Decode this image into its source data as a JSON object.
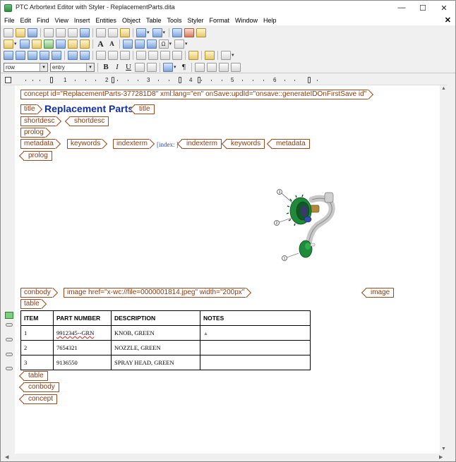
{
  "window": {
    "title": "PTC Arbortext Editor with Styler - ReplacementParts.dita",
    "controls": {
      "minimize": "—",
      "maximize": "☐",
      "close": "✕"
    }
  },
  "menu": {
    "items": [
      "File",
      "Edit",
      "Find",
      "View",
      "Insert",
      "Entities",
      "Object",
      "Table",
      "Tools",
      "Styler",
      "Format",
      "Window",
      "Help"
    ],
    "doc_close": "✕"
  },
  "toolbar": {
    "element_combo": "row",
    "style_combo": "entry",
    "format_buttons": {
      "bold": "B",
      "italic": "I",
      "underline": "U"
    },
    "pilcrow": "¶",
    "font_grow": "A",
    "font_shrink": "A"
  },
  "ruler": {
    "numbers": [
      "1",
      "2",
      "3",
      "4",
      "5",
      "6"
    ]
  },
  "document": {
    "concept_start": "concept id=\"ReplacementParts-377281D8\" xml:lang=\"en\" onSave:updId=\"onsave::generateIDOnFirstSave id\"",
    "title_tag": "title",
    "title_text": "Replacement Parts",
    "shortdesc_tag": "shortdesc",
    "prolog_tag": "prolog",
    "metadata_tag": "metadata",
    "keywords_tag": "keywords",
    "indexterm_tag": "indexterm",
    "index_text": "[index: ]",
    "conbody_tag": "conbody",
    "image_start": "image href=\"x-wc://file=0000001814.jpeg\" width=\"200px\"",
    "image_tag": "image",
    "table_tag": "table",
    "concept_tag": "concept"
  },
  "figure": {
    "callouts": [
      "3",
      "2",
      "1"
    ],
    "colors": {
      "green": "#1f8a3a",
      "brass": "#b08a3a",
      "silver": "#b8b8b8"
    }
  },
  "table": {
    "headers": [
      "ITEM",
      "PART NUMBER",
      "DESCRIPTION",
      "NOTES"
    ],
    "rows": [
      {
        "item": "1",
        "part": "9912345--GRN",
        "desc": "KNOB, GREEN",
        "notes": ""
      },
      {
        "item": "2",
        "part": "7654321",
        "desc": "NOZZLE, GREEN",
        "notes": ""
      },
      {
        "item": "3",
        "part": "9136550",
        "desc": "SPRAY HEAD, GREEN",
        "notes": ""
      }
    ]
  },
  "colors": {
    "tag_border": "#9a4a1c",
    "tag_text": "#8a3a10",
    "title_blue": "#1030a0"
  }
}
